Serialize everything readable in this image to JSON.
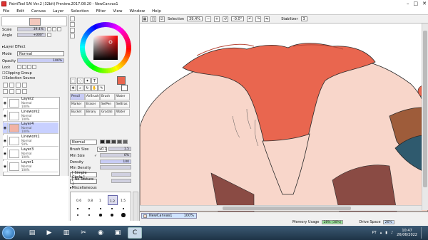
{
  "window": {
    "title": "PaintTool SAI Ver.2 (32bit) Preview.2017.08.20 - NewCanvas1",
    "min": "–",
    "max": "□",
    "close": "✕"
  },
  "menu": [
    "File",
    "Edit",
    "Canvas",
    "Layer",
    "Selection",
    "Filter",
    "View",
    "Window",
    "Help"
  ],
  "toolbar": {
    "selection_label": "Selection",
    "zoom": "39.4%",
    "angle": "-0.0°",
    "stabilizer_label": "Stabilizer",
    "stabilizer": "3"
  },
  "color": {
    "main": "#e9664f",
    "bg": "#ffffff",
    "ring_hue": "#ff0000"
  },
  "layer_props": {
    "scale_label": "Scale",
    "scale": "39.4%",
    "angle_label": "Angle",
    "angle": "+000°",
    "layer_effect": "Layer Effect",
    "mode_label": "Mode",
    "mode": "Normal",
    "opacity_label": "Opacity",
    "opacity": "100%",
    "lock_label": "Lock",
    "clipping": "Clipping Group",
    "selection_source": "Selection Source"
  },
  "layers": [
    {
      "name": "Layer2",
      "mode": "Normal",
      "opacity": "100%"
    },
    {
      "name": "Linework2",
      "mode": "Normal",
      "opacity": "100%"
    },
    {
      "name": "Layer4",
      "mode": "Normal",
      "opacity": "100%"
    },
    {
      "name": "Linework1",
      "mode": "Normal",
      "opacity": "50%"
    },
    {
      "name": "Layer3",
      "mode": "Normal",
      "opacity": "100%"
    },
    {
      "name": "Layer1",
      "mode": "Normal",
      "opacity": "100%"
    }
  ],
  "tools": [
    "Pencil",
    "AirBrush",
    "Brush",
    "Water",
    "Marker",
    "Eraser",
    "SelPen",
    "SelEras",
    "Bucket",
    "Binary",
    "Gradati",
    "Water"
  ],
  "brush": {
    "mode": "Normal",
    "size_label": "Brush Size",
    "size_mult": "x0.1",
    "size": "1.5",
    "min_size_label": "Min Size",
    "min_size": "0%",
    "density_label": "Density",
    "density": "100",
    "min_density_label": "Min Density",
    "min_density": "",
    "circle": "[ Simple Circle ]",
    "texture": "[ No Texture ]",
    "misc": "Miscellaneous",
    "presets": [
      "0.6",
      "0.8",
      "1",
      "1.2",
      "1.5"
    ]
  },
  "nav": {
    "canvas_name": "NewCanvas1",
    "zoom": "100%"
  },
  "status": {
    "memory_label": "Memory Usage",
    "memory": "28% (30%)",
    "drive_label": "Drive Space",
    "drive": "26%"
  },
  "taskbar": {
    "lang": "PT",
    "time": "10:47",
    "date": "26/06/2022"
  }
}
